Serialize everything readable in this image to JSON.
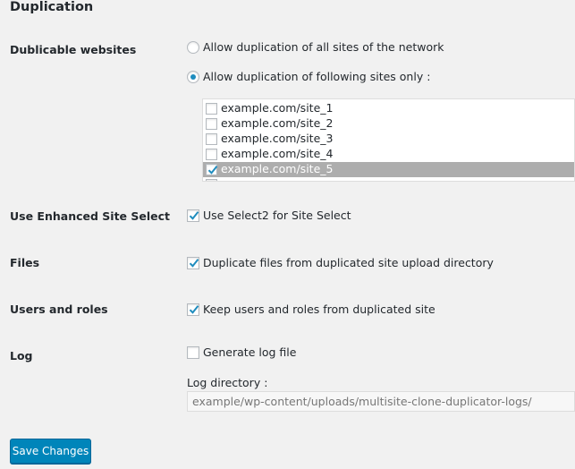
{
  "section_title": "Duplication",
  "dublicable": {
    "label": "Dublicable websites",
    "radio_all": "Allow duplication of all sites of the network",
    "radio_selected": "Allow duplication of following sites only :",
    "selected_option": "following sites only",
    "sites": [
      {
        "label": "example.com/site_1",
        "checked": false
      },
      {
        "label": "example.com/site_2",
        "checked": false
      },
      {
        "label": "example.com/site_3",
        "checked": false
      },
      {
        "label": "example.com/site_4",
        "checked": false
      },
      {
        "label": "example.com/site_5",
        "checked": true
      }
    ]
  },
  "enhanced_select": {
    "label": "Use Enhanced Site Select",
    "option": "Use Select2 for Site Select",
    "checked": true
  },
  "files": {
    "label": "Files",
    "option": "Duplicate files from duplicated site upload directory",
    "checked": true
  },
  "users": {
    "label": "Users and roles",
    "option": "Keep users and roles from duplicated site",
    "checked": true
  },
  "log": {
    "label": "Log",
    "option": "Generate log file",
    "checked": false,
    "directory_label": "Log directory :",
    "directory_value": "example/wp-content/uploads/multisite-clone-duplicator-logs/"
  },
  "save_label": "Save Changes",
  "colors": {
    "accent": "#0085ba",
    "background": "#f1f1f1",
    "selected_row": "#adadad",
    "check_mark": "#1e8cbe"
  }
}
